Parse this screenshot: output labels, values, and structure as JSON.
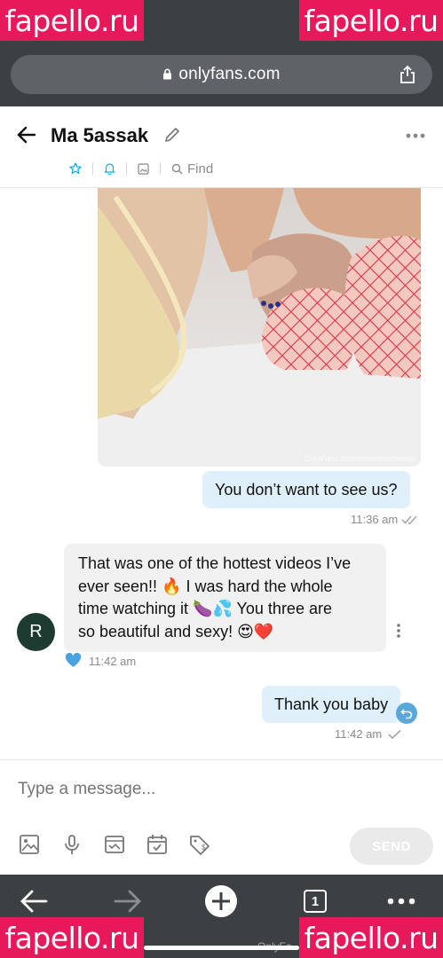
{
  "watermarks": {
    "top_left": "fapello.ru",
    "top_right": "fapello.ru",
    "bottom_left": "fapello.ru",
    "bottom_right": "fapello.ru"
  },
  "browser": {
    "url": "onlyfans.com",
    "tab_count": "1",
    "bottom_caption": "OnlyFa"
  },
  "chat": {
    "name": "Ma 5assak",
    "find_label": "Find"
  },
  "photo": {
    "watermark": "OnlyFans.com/brookesnicewnu"
  },
  "messages": [
    {
      "from": "me",
      "text": "You don’t want to see us?",
      "time": "11:36 am"
    },
    {
      "from": "them",
      "avatar_letter": "R",
      "text_lines": [
        "That was one of the hottest videos I’ve",
        "ever seen!! 🔥 I was hard the whole",
        "time watching it 🍆💦 You three are",
        "so beautiful and sexy! 😍❤️"
      ],
      "time": "11:42 am"
    },
    {
      "from": "me",
      "text": "Thank you baby",
      "time": "11:42 am"
    }
  ],
  "composer": {
    "placeholder": "Type a message...",
    "send_label": "SEND"
  },
  "colors": {
    "chrome": "#3c4043",
    "outgoing_bubble": "#dff0fa",
    "incoming_bubble": "#f1f1f1",
    "accent": "#00aff0",
    "watermark": "#e8195a"
  }
}
